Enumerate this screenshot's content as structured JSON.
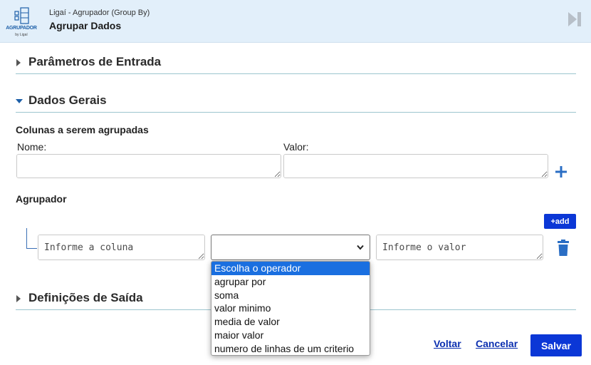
{
  "header": {
    "logo_text": "AGRUPADOR",
    "logo_by": "by Ligaí",
    "subtitle": "Ligaí - Agrupador (Group By)",
    "title": "Agrupar Dados",
    "skip_icon": "skip-forward-icon"
  },
  "sections": {
    "input_params": "Parâmetros de Entrada",
    "general_data": "Dados Gerais",
    "output_defs": "Definições de Saída"
  },
  "columns": {
    "heading": "Colunas a serem agrupadas",
    "name_label": "Nome:",
    "value_label": "Valor:",
    "name_value": "",
    "value_value": ""
  },
  "grouper": {
    "heading": "Agrupador",
    "add_label": "+add",
    "column_placeholder": "Informe a coluna",
    "value_placeholder": "Informe o valor",
    "operator_selected": ""
  },
  "operator_options": [
    "Escolha o operador",
    "agrupar por",
    "soma",
    "valor minimo",
    "media de valor",
    "maior valor",
    "numero de linhas de um criterio"
  ],
  "footer": {
    "back": "Voltar",
    "cancel": "Cancelar",
    "save": "Salvar"
  },
  "colors": {
    "header_bg": "#e2effa",
    "primary_button": "#0b37d6",
    "link": "#0b2fb0",
    "section_divider": "#9cc5cf",
    "option_highlight": "#1a6fe0"
  }
}
